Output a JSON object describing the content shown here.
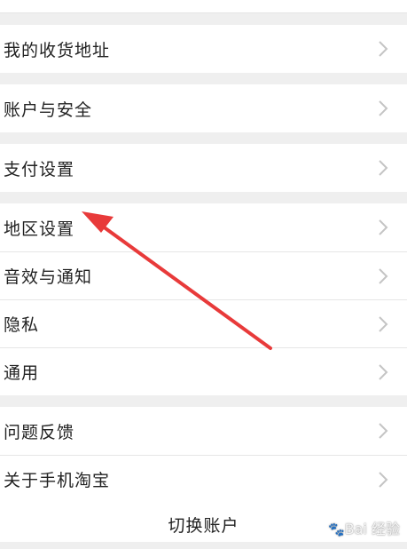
{
  "groups": [
    {
      "rows": [
        {
          "label": "我的收货地址"
        }
      ]
    },
    {
      "rows": [
        {
          "label": "账户与安全"
        }
      ]
    },
    {
      "rows": [
        {
          "label": "支付设置"
        }
      ]
    },
    {
      "rows": [
        {
          "label": "地区设置"
        },
        {
          "label": "音效与通知"
        },
        {
          "label": "隐私"
        },
        {
          "label": "通用"
        }
      ]
    },
    {
      "rows": [
        {
          "label": "问题反馈"
        },
        {
          "label": "关于手机淘宝"
        }
      ]
    }
  ],
  "logout_label": "切换账户",
  "watermark": {
    "text": "Bai 经验",
    "paw": "🐾"
  },
  "annotation": {
    "color": "#e83a3a",
    "points_to": "地区设置"
  },
  "colors": {
    "background": "#efefef",
    "row": "#ffffff",
    "chevron": "#c4c4c4",
    "text": "#222222"
  }
}
